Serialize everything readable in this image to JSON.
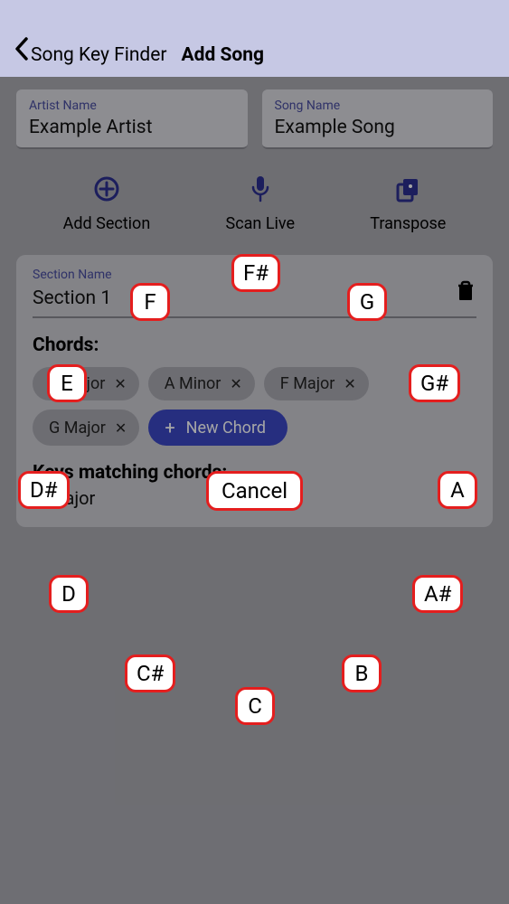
{
  "header": {
    "back_label": "Song Key Finder",
    "title": "Add Song"
  },
  "inputs": {
    "artist": {
      "label": "Artist Name",
      "value": "Example Artist"
    },
    "song": {
      "label": "Song Name",
      "value": "Example Song"
    }
  },
  "actions": {
    "add_section": "Add Section",
    "scan_live": "Scan Live",
    "transpose": "Transpose"
  },
  "section": {
    "name_label": "Section Name",
    "name_value": "Section 1",
    "chords_heading": "Chords:",
    "chords": [
      "C Major",
      "A Minor",
      "F Major",
      "G Major"
    ],
    "new_chord_label": "New Chord",
    "keys_heading": "Keys matching chords:",
    "key_match": "C Major"
  },
  "picker": {
    "cancel": "Cancel",
    "notes": [
      "F#",
      "G",
      "G#",
      "A",
      "A#",
      "B",
      "C",
      "C#",
      "D",
      "D#",
      "E",
      "F"
    ]
  }
}
